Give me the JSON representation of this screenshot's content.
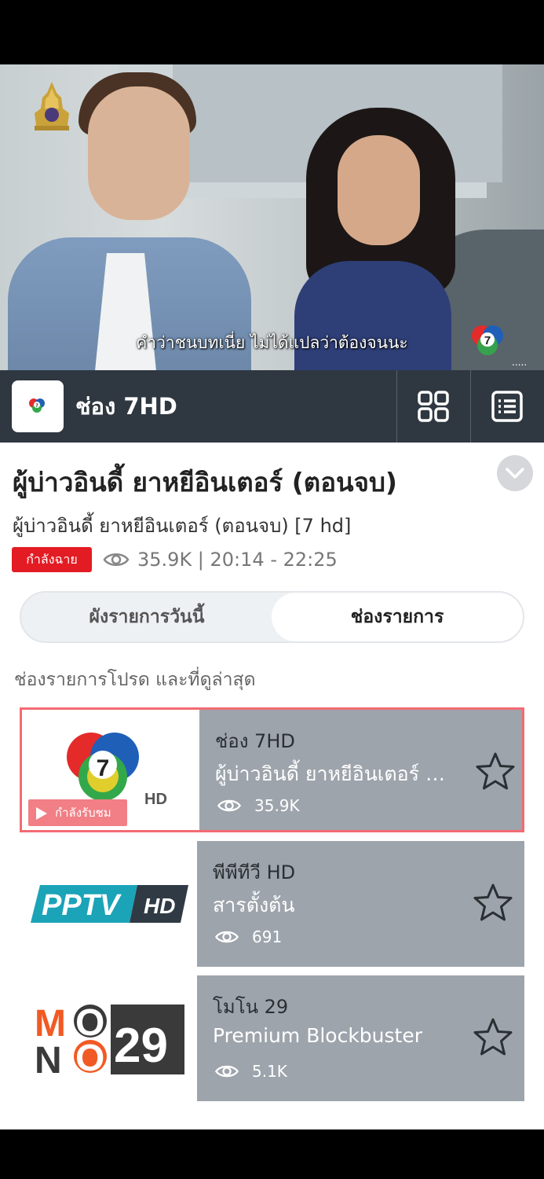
{
  "video": {
    "subtitle": "คำว่าชนบทเนี่ย ไม่ได้แปลว่าต้องจนนะ",
    "watermark_dots": "....."
  },
  "channel_bar": {
    "channel_name": "ช่อง 7HD",
    "grid_icon": "grid-icon",
    "list_icon": "list-icon"
  },
  "program": {
    "title": "ผู้บ่าวอินดี้ ยาหยีอินเตอร์ (ตอนจบ)",
    "subtitle": "ผู้บ่าวอินดี้ ยาหยีอินเตอร์ (ตอนจบ) [7 hd]",
    "live_badge": "กำลังฉาย",
    "stats": "35.9K | 20:14 - 22:25"
  },
  "tabs": {
    "left": "ผังรายการวันนี้",
    "right": "ช่องรายการ",
    "active": "right"
  },
  "section_title": "ช่องรายการโปรด และที่ดูล่าสุด",
  "cards": [
    {
      "name": "ช่อง 7HD",
      "program": "ผู้บ่าวอินดี้ ยาหยีอินเตอร์ (ตอนจบ)",
      "views": "35.9K",
      "badge": "กำลังรับชม",
      "logo": "ch7-hd-logo",
      "active": true
    },
    {
      "name": "พีพีทีวี HD",
      "program": "สารตั้งต้น",
      "views": "691",
      "logo": "pptv-hd-logo",
      "active": false
    },
    {
      "name": "โมโน 29",
      "program": "Premium Blockbuster",
      "views": "5.1K",
      "logo": "mono29-logo",
      "active": false
    }
  ],
  "logos": {
    "pptv_text": "PPTV",
    "pptv_hd": "HD",
    "mono_m": "M",
    "mono_o1": "O",
    "mono_n": "N",
    "mono_o2": "O",
    "mono_num": "29",
    "ch7_num": "7",
    "ch7_hd": "HD"
  },
  "colors": {
    "channel_bar": "#2f3740",
    "live_red": "#e31b23",
    "card_bg": "#9ea4ac",
    "active_border": "#f26b73",
    "mono_orange": "#f15a24"
  }
}
